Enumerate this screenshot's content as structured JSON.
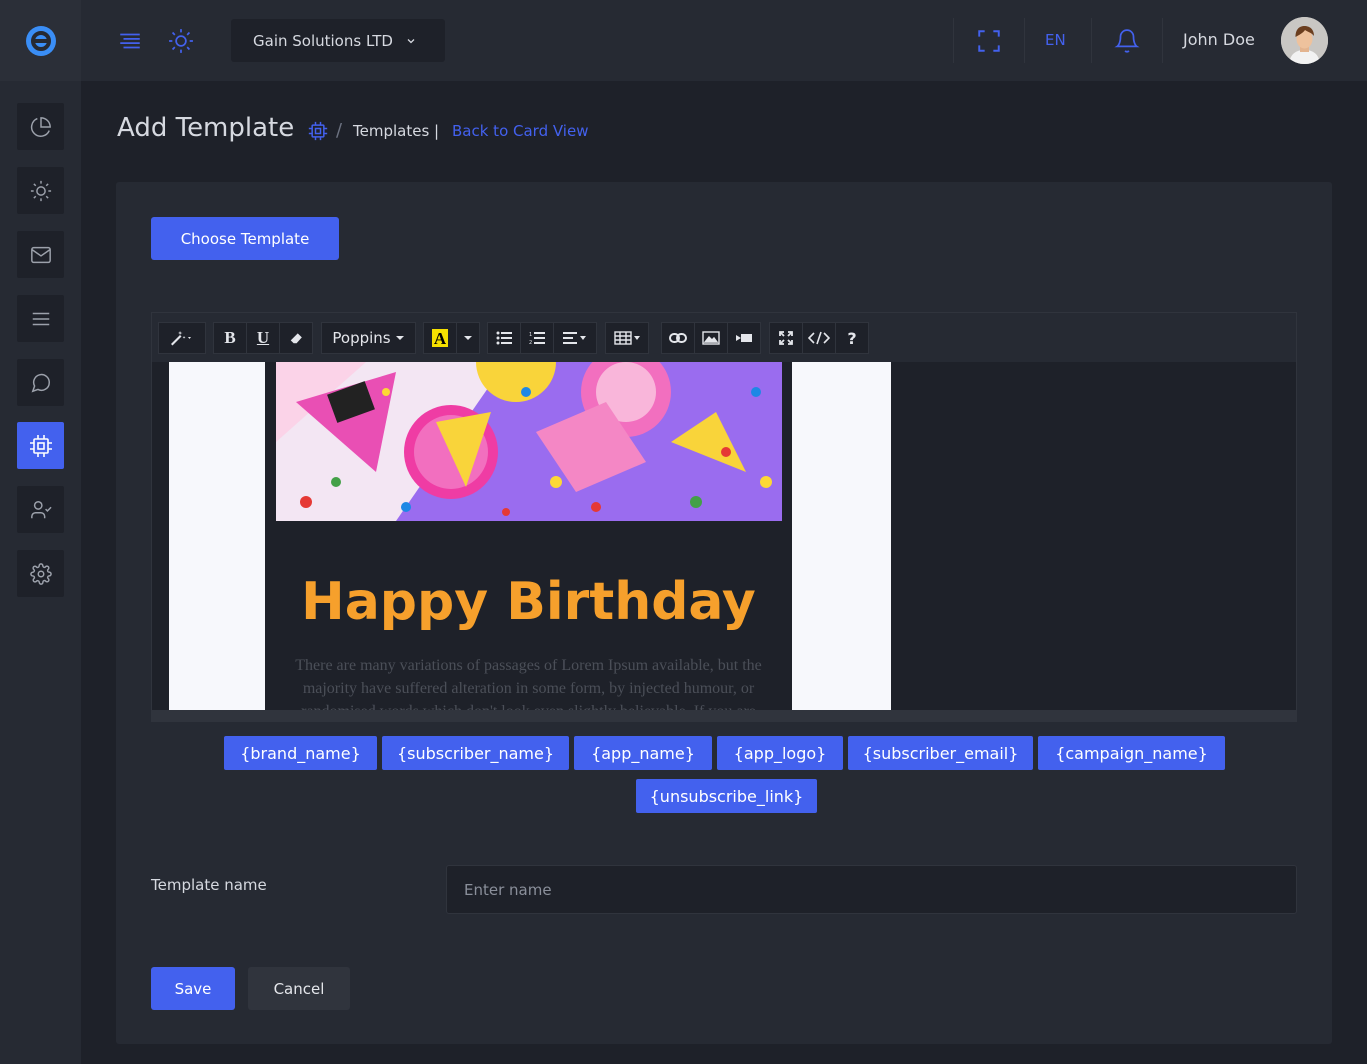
{
  "company": "Gain Solutions LTD",
  "language": "EN",
  "user": {
    "name": "John Doe"
  },
  "page": {
    "title": "Add Template"
  },
  "breadcrumb": {
    "templates": "Templates |",
    "back": "Back to Card View"
  },
  "choose_template_label": "Choose Template",
  "toolbar": {
    "font": "Poppins",
    "help": "?"
  },
  "email_preview": {
    "heading": "Happy Birthday",
    "text": "There are many variations of passages of Lorem Ipsum available, but the majority have suffered alteration in some form, by injected humour, or randomised words which don't look even slightly believable. If you are"
  },
  "tags": [
    "{brand_name}",
    "{subscriber_name}",
    "{app_name}",
    "{app_logo}",
    "{subscriber_email}",
    "{campaign_name}",
    "{unsubscribe_link}"
  ],
  "form": {
    "template_name_label": "Template name",
    "template_name_placeholder": "Enter name"
  },
  "actions": {
    "save": "Save",
    "cancel": "Cancel"
  },
  "colors": {
    "accent": "#4361ee",
    "heading": "#f6a02c",
    "background": "#1e2129",
    "panel": "#262a33"
  },
  "sidebar_icons": [
    "pie-chart-icon",
    "sun-icon",
    "mail-icon",
    "menu-icon",
    "chat-icon",
    "cpu-icon",
    "user-check-icon",
    "settings-icon"
  ]
}
